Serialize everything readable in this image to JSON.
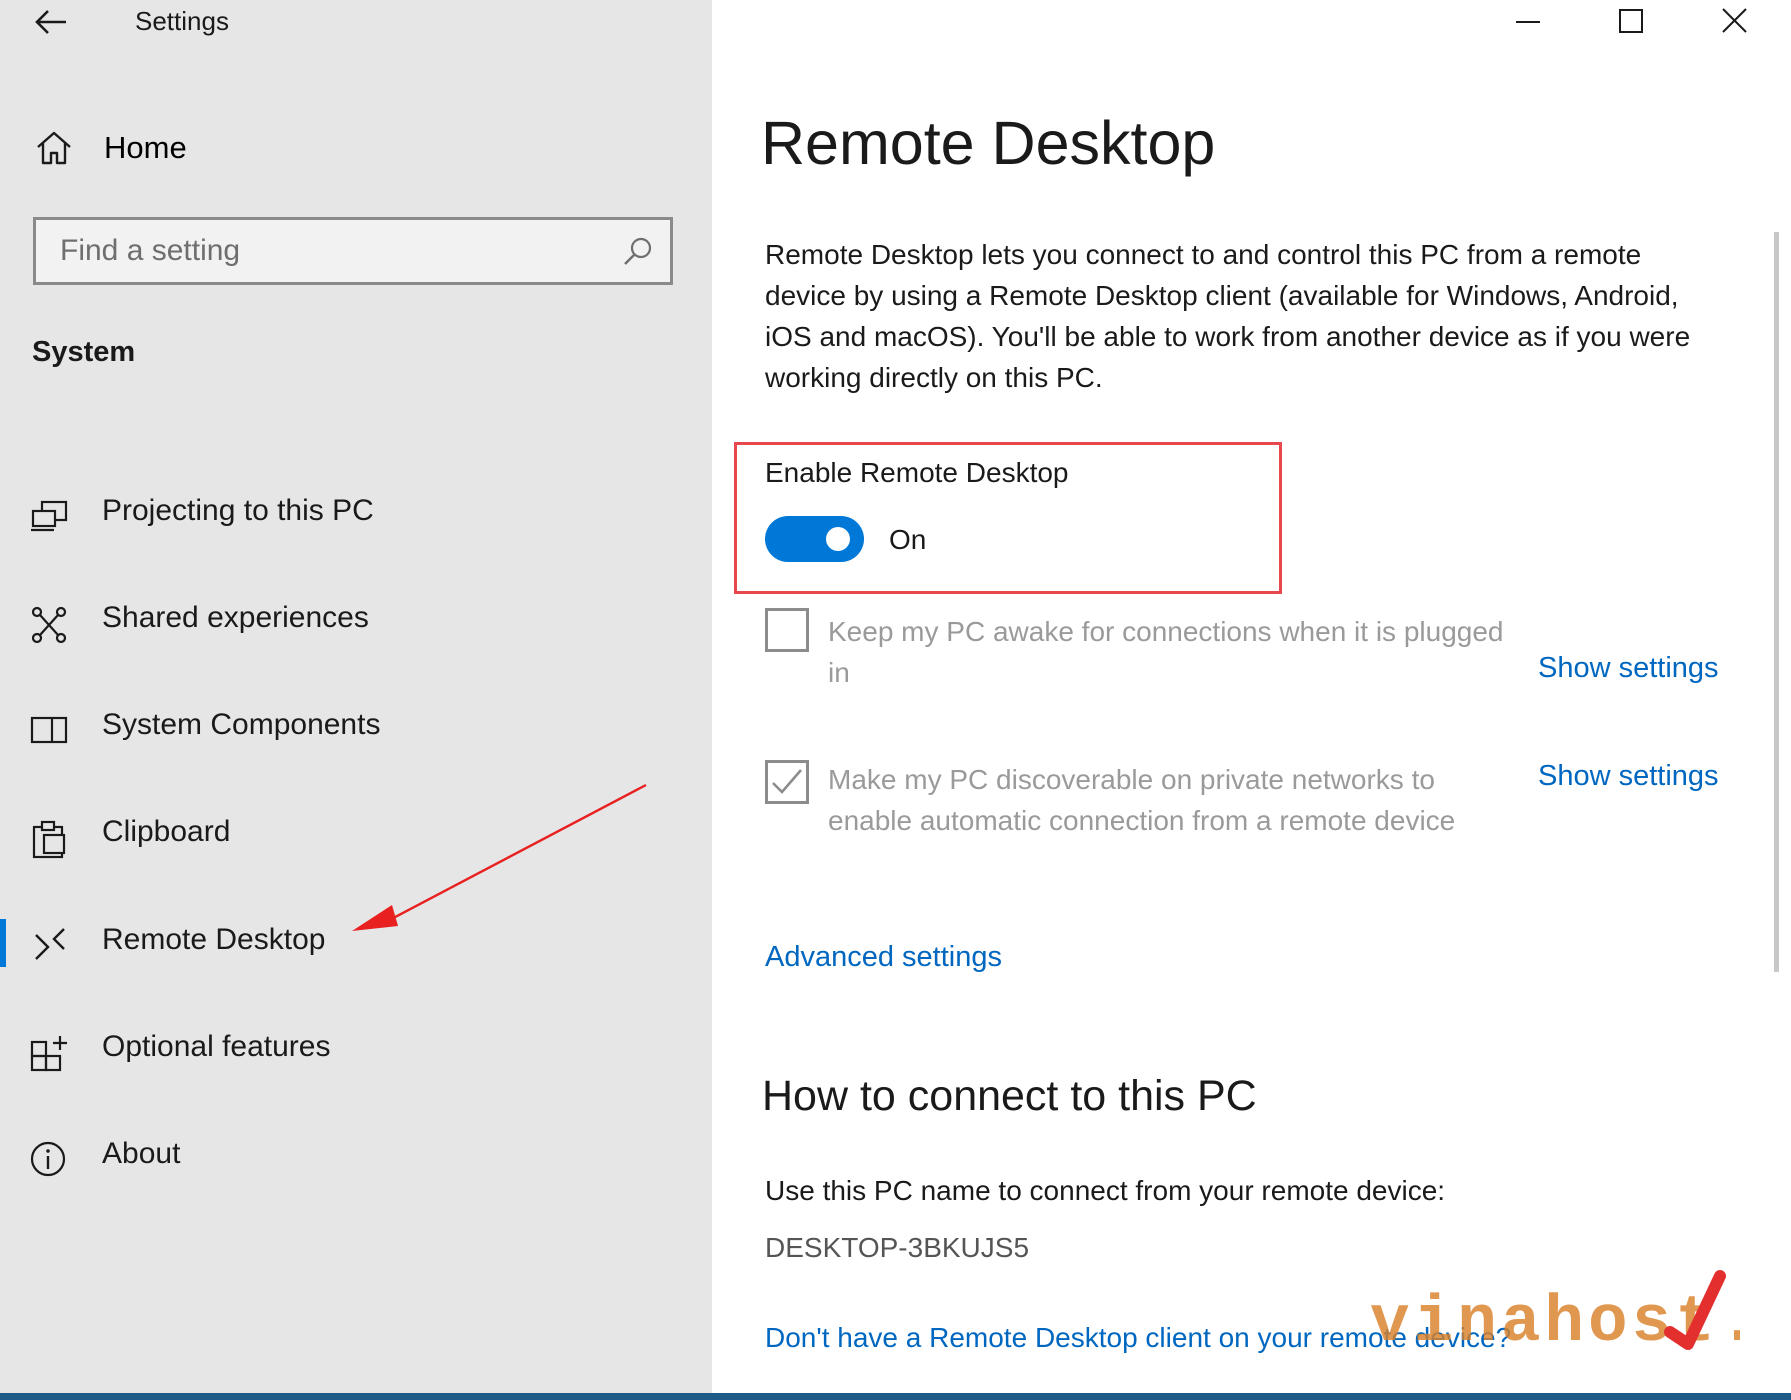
{
  "window": {
    "title": "Settings",
    "controls": [
      "minimize",
      "maximize",
      "close"
    ]
  },
  "sidebar": {
    "home_label": "Home",
    "search": {
      "placeholder": "Find a setting",
      "icon": "search-icon"
    },
    "section_title": "System",
    "items": [
      {
        "label": "Projecting to this PC",
        "icon": "projector-icon",
        "selected": false
      },
      {
        "label": "Shared experiences",
        "icon": "shared-experiences-icon",
        "selected": false
      },
      {
        "label": "System Components",
        "icon": "system-components-icon",
        "selected": false
      },
      {
        "label": "Clipboard",
        "icon": "clipboard-icon",
        "selected": false
      },
      {
        "label": "Remote Desktop",
        "icon": "remote-desktop-icon",
        "selected": true
      },
      {
        "label": "Optional features",
        "icon": "optional-features-icon",
        "selected": false
      },
      {
        "label": "About",
        "icon": "info-icon",
        "selected": false
      }
    ]
  },
  "main": {
    "title": "Remote Desktop",
    "description": "Remote Desktop lets you connect to and control this PC from a remote device by using a Remote Desktop client (available for Windows, Android, iOS and macOS). You'll be able to work from another device as if you were working directly on this PC.",
    "enable": {
      "label": "Enable Remote Desktop",
      "state_label": "On",
      "checked": true
    },
    "options": [
      {
        "label": "Keep my PC awake for connections when it is plugged in",
        "checked": false,
        "link": "Show settings"
      },
      {
        "label": "Make my PC discoverable on private networks to enable automatic connection from a remote device",
        "checked": true,
        "link": "Show settings"
      }
    ],
    "advanced_link": "Advanced settings",
    "connect": {
      "heading": "How to connect to this PC",
      "instruction": "Use this PC name to connect from your remote device:",
      "pc_name": "DESKTOP-3BKUJS5",
      "client_link": "Don't have a Remote Desktop client on your remote device?"
    }
  },
  "watermark": {
    "text": "vinahost."
  },
  "colors": {
    "accent": "#0078d7",
    "link": "#0067c0",
    "highlight": "#e8474c",
    "sidebar_bg": "#e6e6e6"
  }
}
